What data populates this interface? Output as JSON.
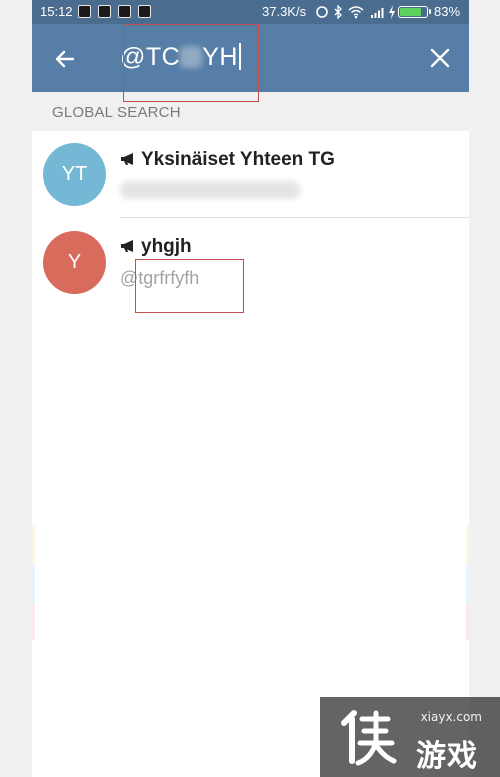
{
  "status_bar": {
    "time": "15:12",
    "network_speed": "37.3K/s",
    "battery_percent": "83%",
    "battery_level": 0.83,
    "icons": [
      "sync-icon",
      "bluetooth-icon",
      "wifi-icon",
      "signal-icon",
      "charging-icon"
    ]
  },
  "header": {
    "back_icon": "arrow-left-icon",
    "search_query_prefix": "@TC",
    "search_query_suffix": "YH",
    "close_icon": "close-icon",
    "background_color": "#577ea6"
  },
  "section": {
    "title": "GLOBAL SEARCH"
  },
  "results": [
    {
      "avatar_initials": "YT",
      "avatar_color": "#74b8d6",
      "type_icon": "megaphone-icon",
      "title": "Yksinäiset Yhteen TG",
      "subtitle": ""
    },
    {
      "avatar_initials": "Y",
      "avatar_color": "#d86b5c",
      "type_icon": "megaphone-icon",
      "title": "yhgjh",
      "subtitle": "@tgrfrfyfh"
    }
  ],
  "watermark": {
    "domain": "xiayx.com",
    "brand": "游戏"
  }
}
